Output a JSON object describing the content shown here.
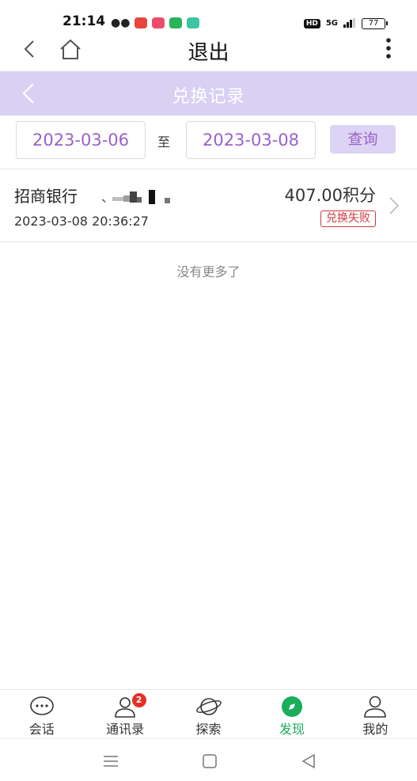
{
  "status_bar": {
    "time": "21:14",
    "network": "5G",
    "battery": "77"
  },
  "topnav": {
    "title": "退出"
  },
  "page_header": {
    "title": "兑换记录"
  },
  "filter": {
    "start_date": "2023-03-06",
    "separator": "至",
    "end_date": "2023-03-08",
    "query_label": "查询"
  },
  "records": [
    {
      "bank": "招商银行",
      "separator": "、",
      "time": "2023-03-08 20:36:27",
      "points": "407.00积分",
      "status": "兑换失败"
    }
  ],
  "no_more_text": "没有更多了",
  "tabs": [
    {
      "label": "会话",
      "icon": "chat-bubble-icon"
    },
    {
      "label": "通讯录",
      "icon": "contacts-icon",
      "badge": "2"
    },
    {
      "label": "探索",
      "icon": "planet-icon"
    },
    {
      "label": "发现",
      "icon": "compass-icon",
      "active": true
    },
    {
      "label": "我的",
      "icon": "person-icon"
    }
  ],
  "colors": {
    "header_bg": "#d9d1f3",
    "accent_purple": "#9a62c9",
    "status_red": "#d0383e",
    "active_green": "#1aad5a"
  }
}
